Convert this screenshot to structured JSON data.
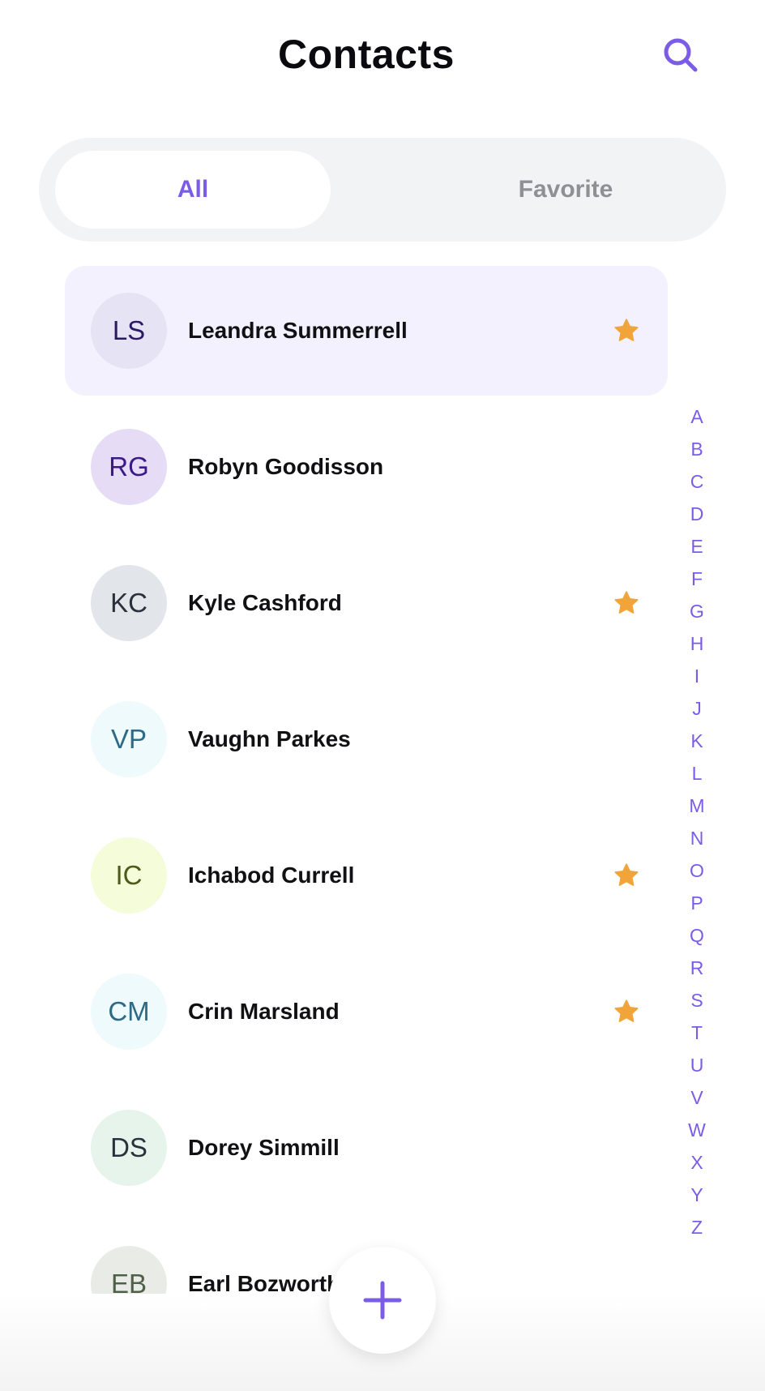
{
  "header": {
    "title": "Contacts",
    "search_icon": "search-icon"
  },
  "colors": {
    "accent": "#7b5ce6",
    "star": "#f0a43a",
    "selected_row_bg": "#f3f1fd"
  },
  "tabs": [
    {
      "label": "All",
      "selected": true
    },
    {
      "label": "Favorite",
      "selected": false
    }
  ],
  "contacts": [
    {
      "initials": "LS",
      "name": "Leandra Summerrell",
      "favorite": true,
      "selected": true,
      "avatar_bg": "#e6e3f4",
      "avatar_fg": "#2a1a66"
    },
    {
      "initials": "RG",
      "name": "Robyn Goodisson",
      "favorite": false,
      "selected": false,
      "avatar_bg": "#e6dcf6",
      "avatar_fg": "#3b1a86"
    },
    {
      "initials": "KC",
      "name": "Kyle Cashford",
      "favorite": true,
      "selected": false,
      "avatar_bg": "#e2e5ea",
      "avatar_fg": "#2a313c"
    },
    {
      "initials": "VP",
      "name": "Vaughn Parkes",
      "favorite": false,
      "selected": false,
      "avatar_bg": "#eefafc",
      "avatar_fg": "#2e6a86"
    },
    {
      "initials": "IC",
      "name": "Ichabod Currell",
      "favorite": true,
      "selected": false,
      "avatar_bg": "#f4fcd9",
      "avatar_fg": "#4d5a1c"
    },
    {
      "initials": "CM",
      "name": "Crin Marsland",
      "favorite": true,
      "selected": false,
      "avatar_bg": "#eefafc",
      "avatar_fg": "#2e6a86"
    },
    {
      "initials": "DS",
      "name": "Dorey Simmill",
      "favorite": false,
      "selected": false,
      "avatar_bg": "#e7f4ec",
      "avatar_fg": "#2a313c"
    },
    {
      "initials": "EB",
      "name": "Earl Bozworth",
      "favorite": false,
      "selected": false,
      "avatar_bg": "#e9ece6",
      "avatar_fg": "#4f5f4a"
    }
  ],
  "alphabet": [
    "A",
    "B",
    "C",
    "D",
    "E",
    "F",
    "G",
    "H",
    "I",
    "J",
    "K",
    "L",
    "M",
    "N",
    "O",
    "P",
    "Q",
    "R",
    "S",
    "T",
    "U",
    "V",
    "W",
    "X",
    "Y",
    "Z"
  ],
  "fab": {
    "icon": "plus-icon"
  }
}
